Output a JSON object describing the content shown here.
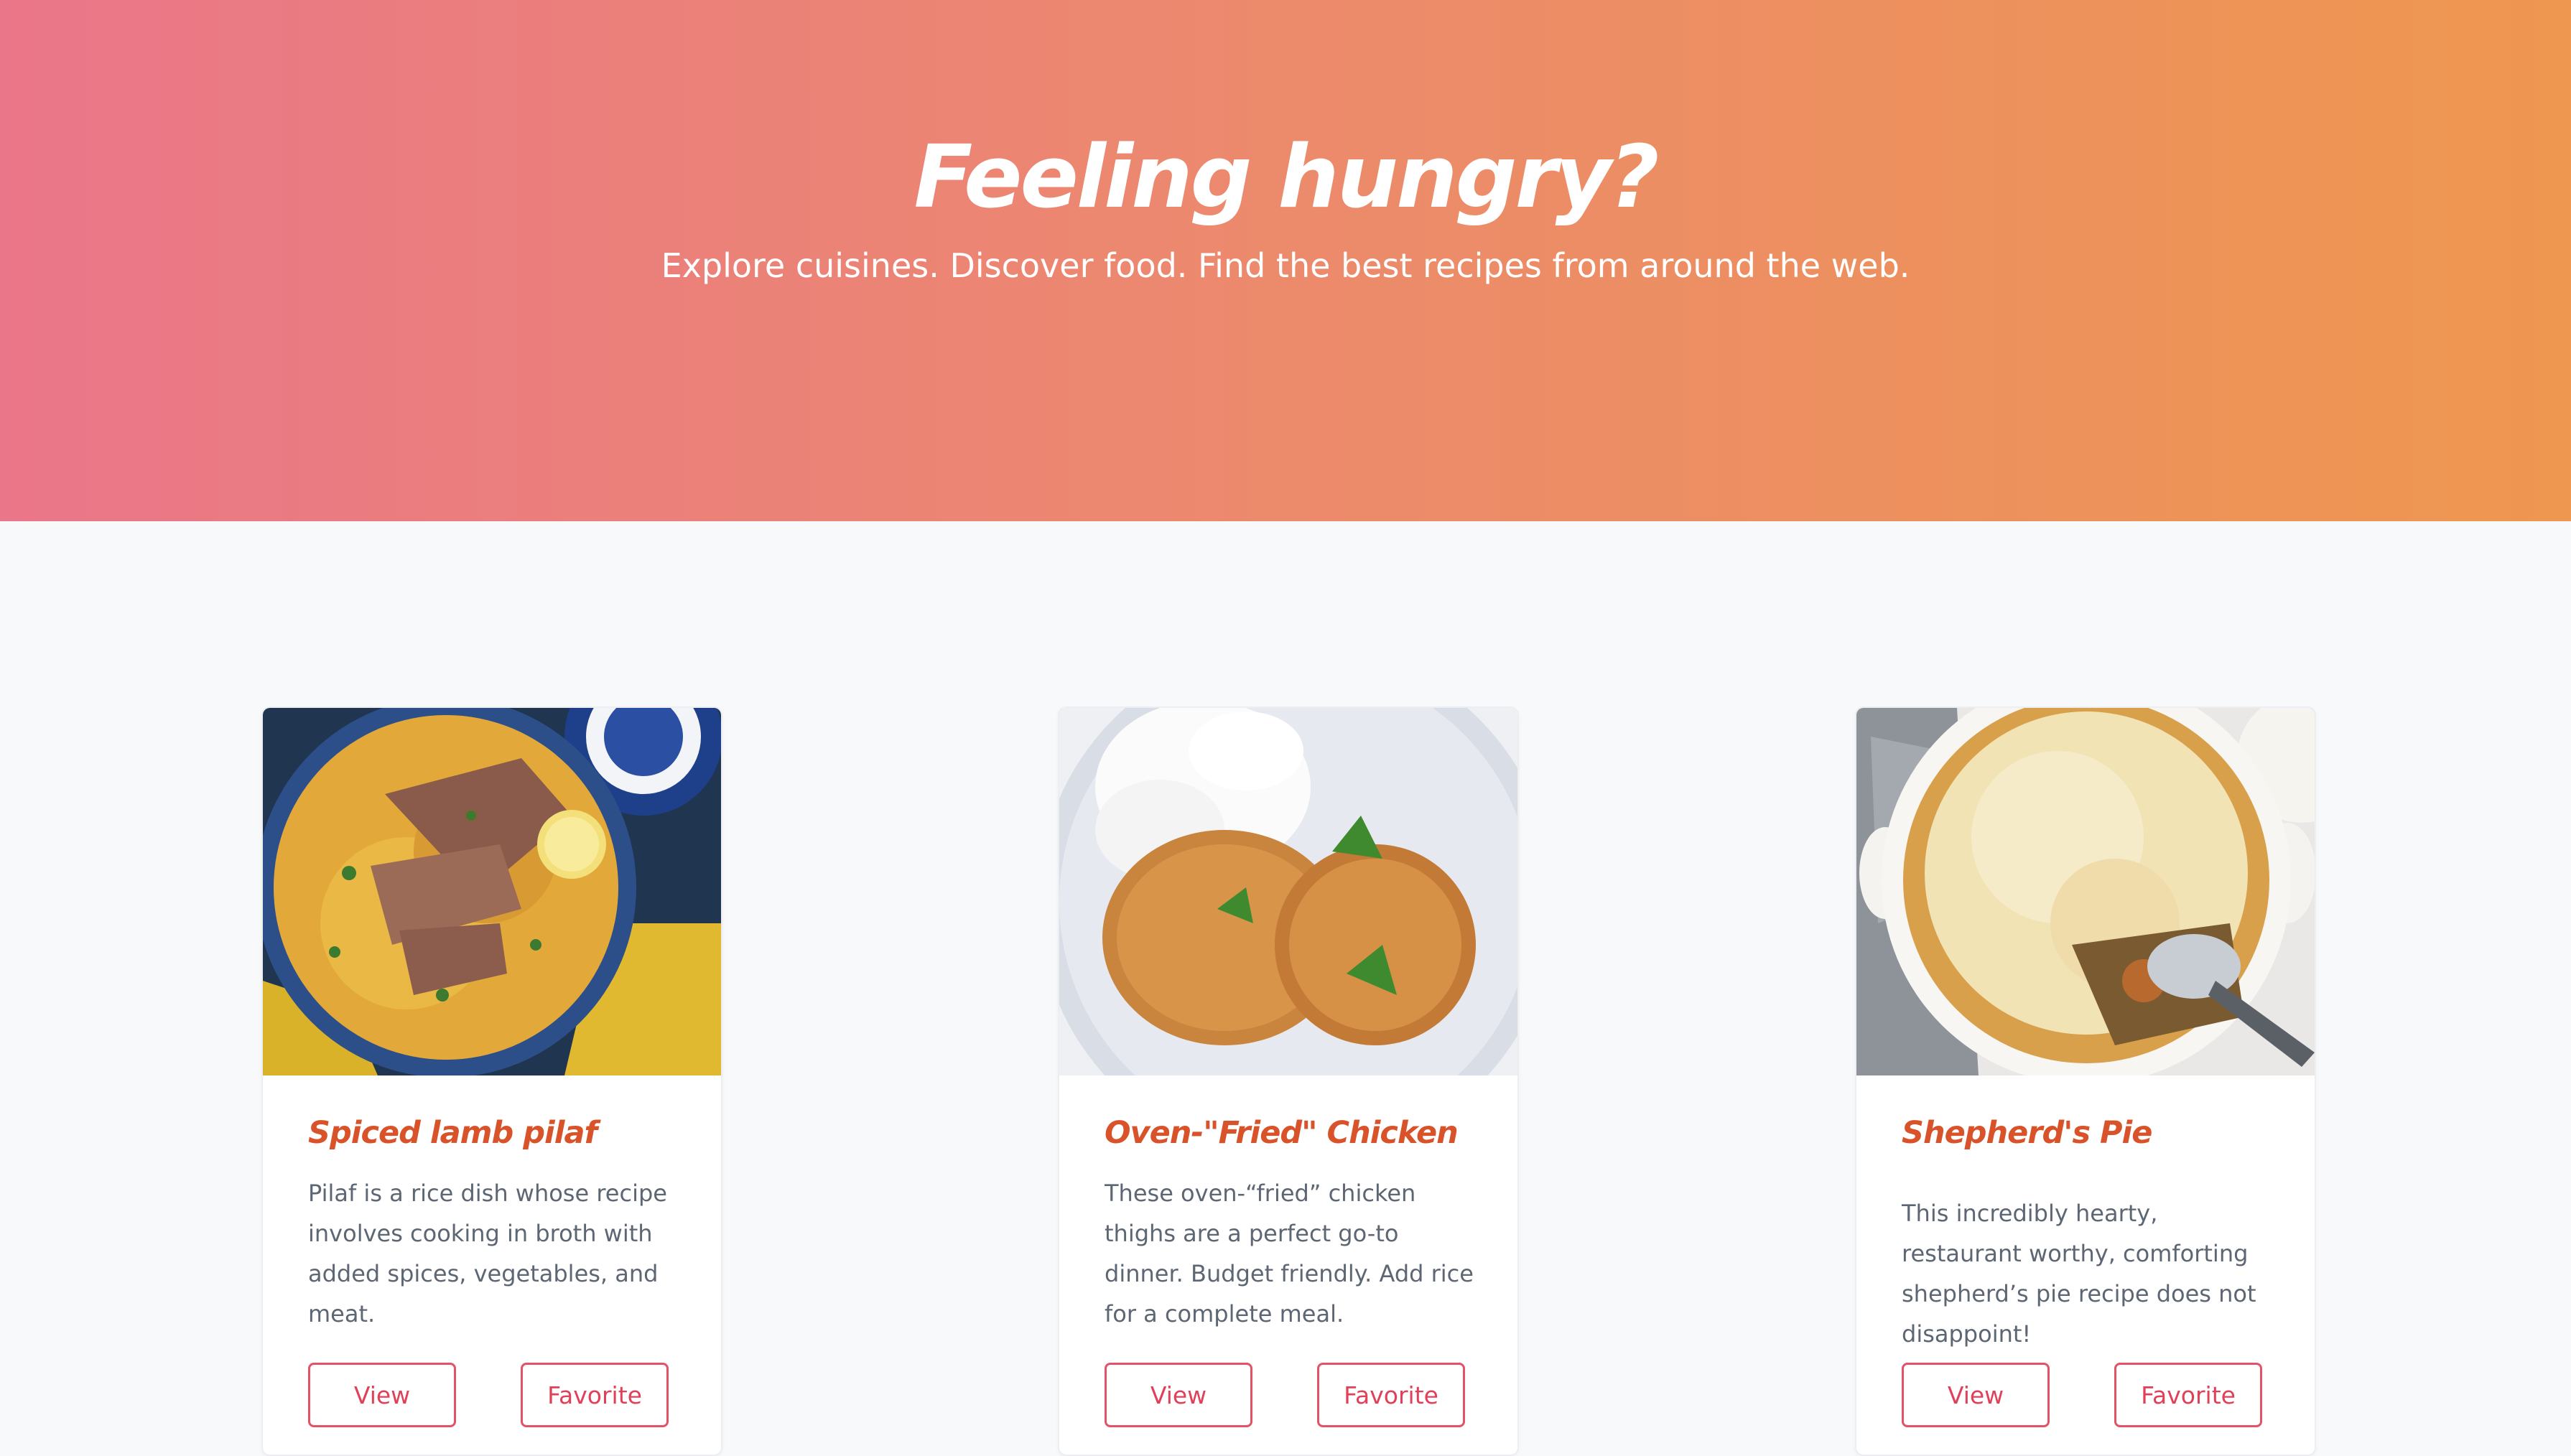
{
  "hero": {
    "title": "Feeling hungry?",
    "subtitle": "Explore cuisines. Discover food. Find the best recipes from around the web.",
    "gradient_start": "#ea7689",
    "gradient_end": "#ee9750"
  },
  "recipes": [
    {
      "title": "Spiced lamb pilaf",
      "description": "Pilaf is a rice dish whose recipe involves cooking in broth with added spices, vegetables, and meat.",
      "image": "lamb-pilaf-photo",
      "view_label": "View",
      "favorite_label": "Favorite"
    },
    {
      "title": "Oven-\"Fried\" Chicken",
      "description": "These oven-“fried” chicken thighs are a perfect go-to dinner. Budget friendly. Add rice for a complete meal.",
      "image": "fried-chicken-photo",
      "view_label": "View",
      "favorite_label": "Favorite"
    },
    {
      "title": "Shepherd's Pie",
      "description": "This incredibly hearty, restaurant worthy, comforting shepherd’s pie recipe does not disappoint!",
      "image": "shepherds-pie-photo",
      "view_label": "View",
      "favorite_label": "Favorite"
    }
  ],
  "colors": {
    "accent": "#e35367",
    "title": "#d9532a",
    "background": "#f8f9fb"
  }
}
